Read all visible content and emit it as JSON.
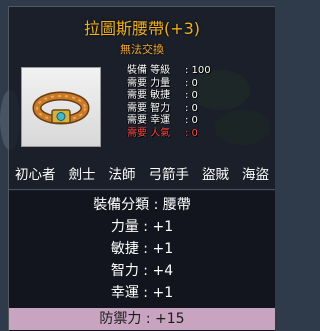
{
  "item": {
    "name": "拉圖斯腰帶(+3)",
    "trade_status": "無法交換",
    "icon": "belt-icon",
    "requirements": [
      {
        "label": "裝備 等級",
        "value": ": 100",
        "met": true
      },
      {
        "label": "需要 力量",
        "value": ": 0",
        "met": true
      },
      {
        "label": "需要 敏捷",
        "value": ": 0",
        "met": true
      },
      {
        "label": "需要 智力",
        "value": ": 0",
        "met": true
      },
      {
        "label": "需要 幸運",
        "value": ": 0",
        "met": true
      },
      {
        "label": "需要 人氣",
        "value": ": 0",
        "met": false
      }
    ],
    "jobs": [
      "初心者",
      "劍士",
      "法師",
      "弓箭手",
      "盜賊",
      "海盜"
    ],
    "stats": [
      "裝備分類 : 腰帶",
      "力量 : +1",
      "敏捷 : +1",
      "智力 : +4",
      "幸運 : +1",
      "防禦力 : +15"
    ]
  },
  "colors": {
    "title": "#f0b020",
    "unmet_requirement": "#ff4444",
    "highlight_row": "#c8a4c0"
  }
}
